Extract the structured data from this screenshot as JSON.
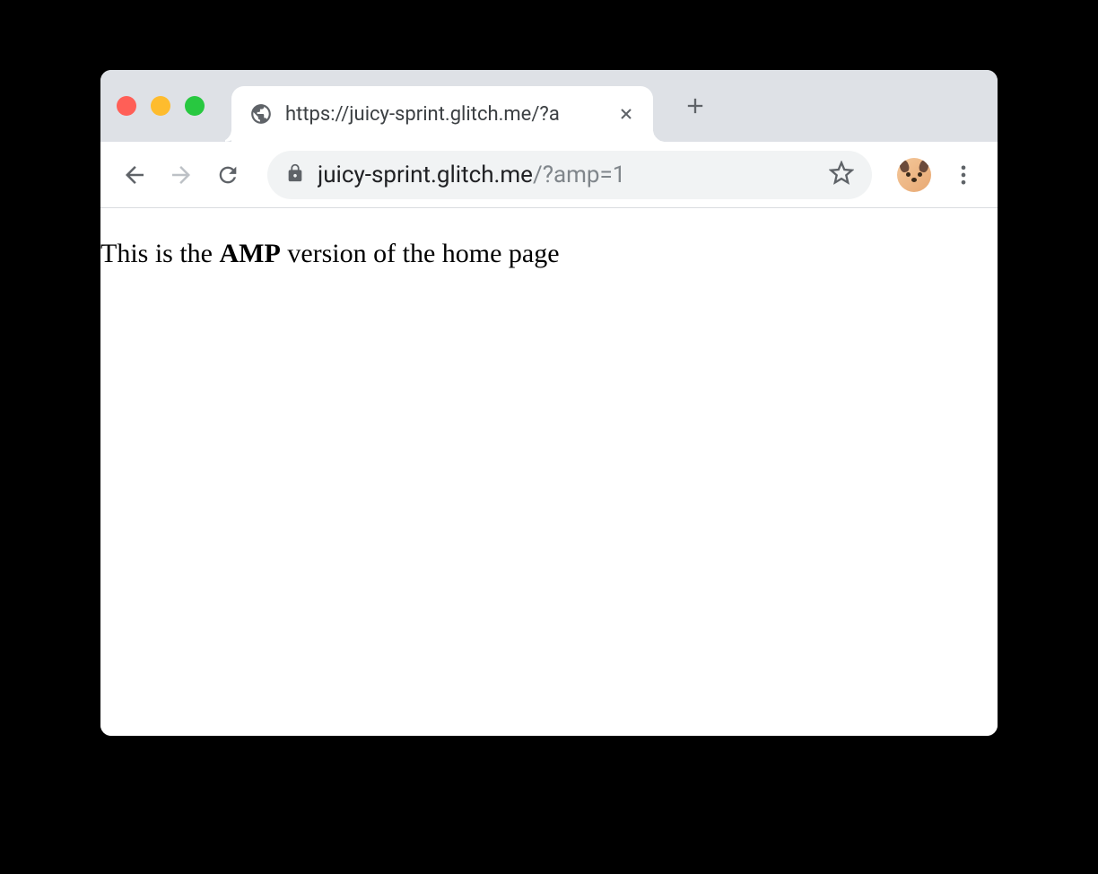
{
  "window": {
    "controls": {
      "close": "close",
      "minimize": "minimize",
      "maximize": "maximize"
    }
  },
  "tab": {
    "title": "https://juicy-sprint.glitch.me/?a",
    "favicon": "globe-icon"
  },
  "toolbar": {
    "back": "Back",
    "forward": "Forward",
    "reload": "Reload",
    "url_domain": "juicy-sprint.glitch.me",
    "url_path": "/?amp=1",
    "bookmark": "Bookmark",
    "menu": "Menu"
  },
  "page": {
    "text_before": "This is the ",
    "text_bold": "AMP",
    "text_after": " version of the home page"
  }
}
